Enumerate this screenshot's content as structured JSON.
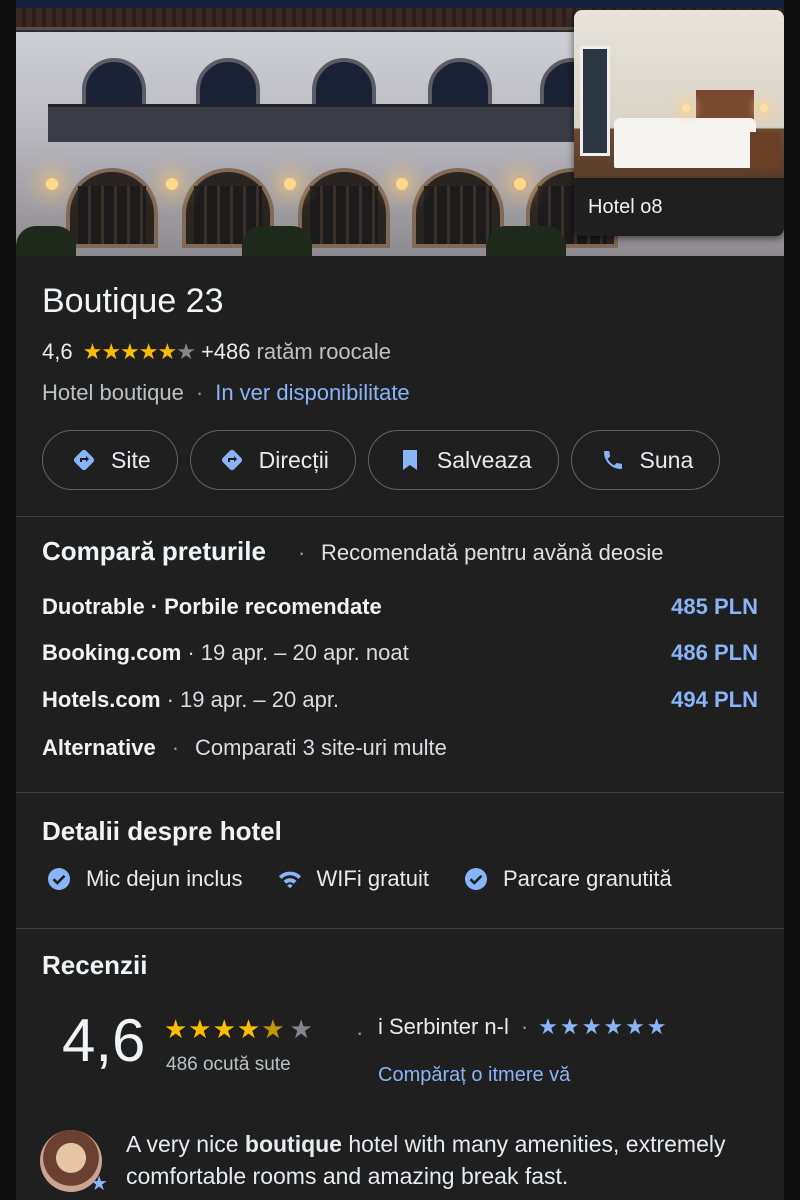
{
  "hero": {
    "thumb_label": "Hotel o8"
  },
  "header": {
    "title": "Boutique 23",
    "rating": "4,6",
    "stars_on": "★★★★★",
    "star_off": "★",
    "reviews": "+486",
    "reviews_label": "ratăm roocale",
    "type": "Hotel boutique",
    "availability_link": "In ver disponibilitate"
  },
  "actions": {
    "site": "Site",
    "directions": "Direcții",
    "save": "Salveaza",
    "call": "Suna"
  },
  "prices": {
    "title": "Compară preturile",
    "subtitle": "Recomendată pentru avănă deosie",
    "rows": [
      {
        "name": "Duotrable",
        "meta": "· Porbile recomendate",
        "price": "485 PLN"
      },
      {
        "name": "Booking.com",
        "meta": "· 19 apr. – 20 apr. noat",
        "price": "486 PLN"
      },
      {
        "name": "Hotels.com",
        "meta": "· 19 apr. – 20 apr.",
        "price": "494 PLN"
      }
    ],
    "alternative_name": "Alternative",
    "alternative_meta": "Comparati 3 site-uri multe"
  },
  "details": {
    "title": "Detalii despre hotel",
    "items": [
      "Mic dejun inclus",
      "WIFi gratuit",
      "Parcare granutită"
    ]
  },
  "reviews": {
    "title": "Recenzii",
    "score": "4,6",
    "stars_on": "★★★★",
    "star_half": "★",
    "star_off": "★",
    "count": "486 ocută sute",
    "source": "i Serbinter n-l",
    "source_stars": "★★★★★★",
    "link": "Compăraț o itmere vă",
    "text_pre": "A very nice ",
    "text_bold": "boutique",
    "text_post": " hotel with many amenities, extremely comfortable rooms and amazing break fast."
  },
  "colors": {
    "accent": "#8ab4f8",
    "star": "#fbbc04",
    "background": "#1f1f1f"
  }
}
